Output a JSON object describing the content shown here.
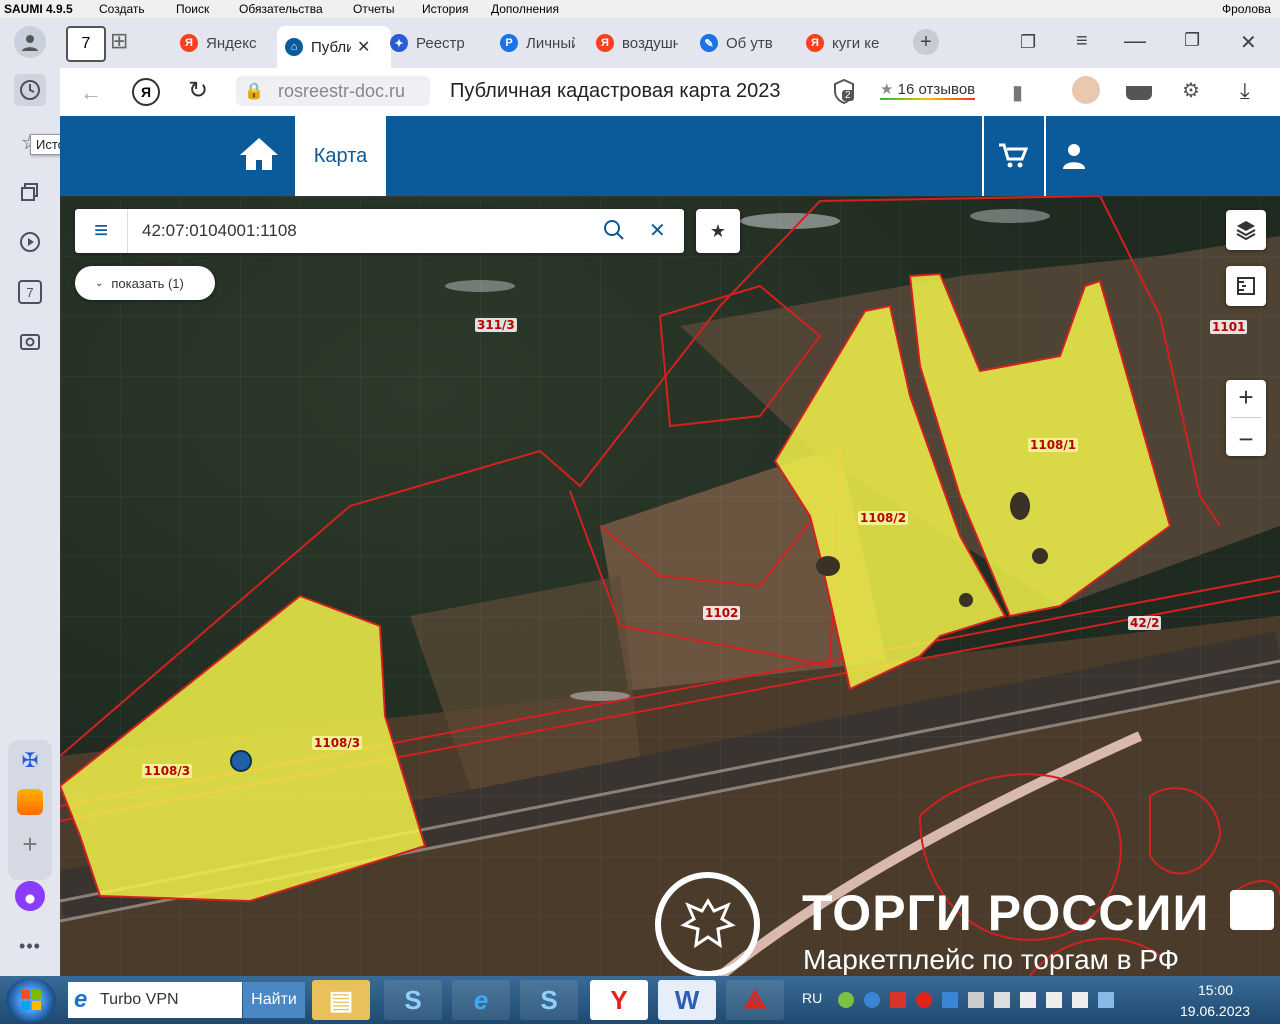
{
  "app_menu": {
    "items": [
      "SAUMI 4.9.5",
      "Создать",
      "Поиск",
      "Обязательства",
      "Отчеты",
      "История",
      "Дополнения"
    ],
    "user": "Фролова"
  },
  "sidebar": {
    "tooltip": "История",
    "badge_number": "7"
  },
  "tabs": {
    "count_badge": "7",
    "items": [
      {
        "label": "Яндекс",
        "icon": "yandex-icon",
        "color": "#fc3f1d"
      },
      {
        "label": "Публичная",
        "icon": "home-icon",
        "color": "#0b5a99",
        "active": true
      },
      {
        "label": "Реестр",
        "icon": "eagle-icon",
        "color": "#2a5bd7"
      },
      {
        "label": "Личный",
        "icon": "document-icon",
        "color": "#1a73e8"
      },
      {
        "label": "воздушная",
        "icon": "yandex-icon",
        "color": "#fc3f1d"
      },
      {
        "label": "Об утв",
        "icon": "document-icon",
        "color": "#1a73e8"
      },
      {
        "label": "куги кемерово",
        "icon": "yandex-icon",
        "color": "#fc3f1d"
      }
    ]
  },
  "address": {
    "domain": "rosreestr-doc.ru",
    "page_title": "Публичная кадастровая карта 2023",
    "reviews": "16 отзывов",
    "shield_count": "2"
  },
  "site": {
    "nav_tab": "Карта"
  },
  "map": {
    "search_value": "42:07:0104001:1108",
    "show_button": "показать (1)",
    "parcel_labels": [
      "311/3",
      "1101",
      "1108/1",
      "1108/2",
      "1102",
      "42/2",
      "1108/3",
      "1108/3"
    ],
    "zoom_in": "+",
    "zoom_out": "−"
  },
  "watermark": {
    "title": "ТОРГИ РОССИИ",
    "subtitle": "Маркетплейс по торгам в РФ"
  },
  "taskbar": {
    "search_value": "Turbo VPN",
    "search_button": "Найти",
    "lang": "RU",
    "time": "15:00",
    "date": "19.06.2023"
  },
  "colors": {
    "header_blue": "#0b5a99",
    "parcel_yellow": "#f2f24a",
    "boundary_red": "#d42020"
  }
}
